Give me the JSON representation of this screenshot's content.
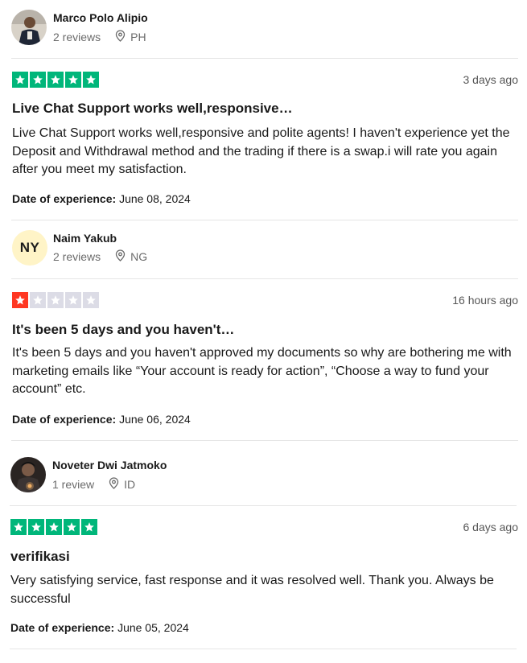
{
  "reviews": [
    {
      "reviewer_name": "Marco Polo Alipio",
      "review_count": "2 reviews",
      "country": "PH",
      "rating": 5,
      "date": "3 days ago",
      "title": "Live Chat Support works well,responsive…",
      "body": "Live Chat Support works well,responsive and polite agents! I haven't experience yet the Deposit and Withdrawal method and the trading if there is a swap.i will rate you again after you meet my satisfaction.",
      "experience_label": "Date of experience:",
      "experience_date": "June 08, 2024"
    },
    {
      "reviewer_name": "Naim Yakub",
      "initials": "NY",
      "review_count": "2 reviews",
      "country": "NG",
      "rating": 1,
      "date": "16 hours ago",
      "title": "It's been 5 days and you haven't…",
      "body": "It's been 5 days and you haven't approved my documents so why are bothering me with marketing emails like “Your account is ready for action”, “Choose a way to fund your account” etc.",
      "experience_label": "Date of experience:",
      "experience_date": "June 06, 2024"
    },
    {
      "reviewer_name": "Noveter Dwi Jatmoko",
      "review_count": "1 review",
      "country": "ID",
      "rating": 5,
      "date": "6 days ago",
      "title": "verifikasi",
      "body": "Very satisfying service, fast response and it was resolved well. Thank you. Always be successful",
      "experience_label": "Date of experience:",
      "experience_date": "June 05, 2024"
    }
  ],
  "colors": {
    "star_5": "#00b67a",
    "star_1": "#ff3722",
    "star_empty": "#dcdce6"
  },
  "icons": {
    "location": "location-pin-icon",
    "star": "star-icon"
  }
}
